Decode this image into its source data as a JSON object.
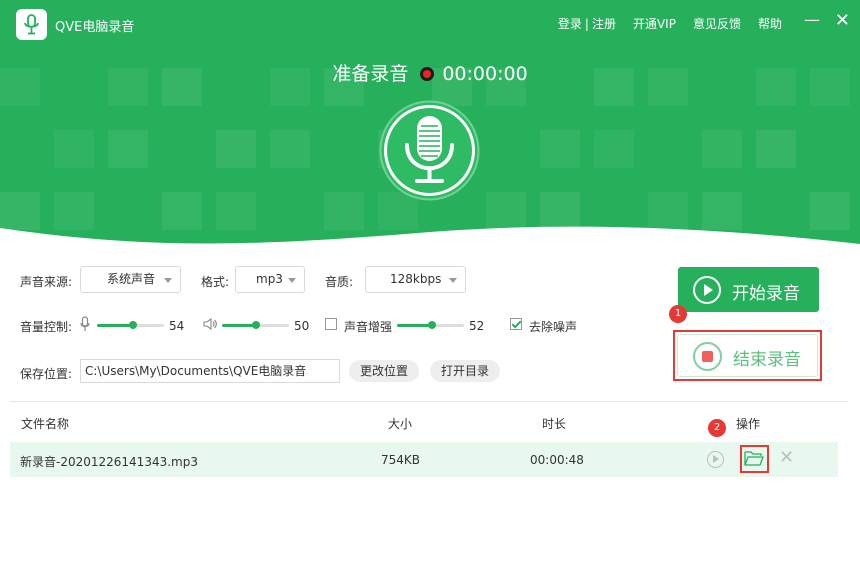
{
  "app": {
    "title": "QVE电脑录音"
  },
  "topnav": {
    "login": "登录",
    "separator": "|",
    "register": "注册",
    "vip": "开通VIP",
    "feedback": "意见反馈",
    "help": "帮助"
  },
  "window": {
    "minimize": "—",
    "close": "✕"
  },
  "status": {
    "text": "准备录音",
    "time": "00:00:00"
  },
  "settings": {
    "source_label": "声音来源:",
    "source_value": "系统声音",
    "format_label": "格式:",
    "format_value": "mp3",
    "quality_label": "音质:",
    "quality_value": "128kbps",
    "volume_label": "音量控制:",
    "mic_volume": 54,
    "speaker_volume": 50,
    "boost_label": "声音增强",
    "boost_checked": false,
    "boost_value": 52,
    "denoise_label": "去除噪声",
    "denoise_checked": true,
    "save_label": "保存位置:",
    "save_path": "C:\\Users\\My\\Documents\\QVE电脑录音",
    "change_location": "更改位置",
    "open_dir": "打开目录"
  },
  "actions": {
    "start": "开始录音",
    "stop": "结束录音"
  },
  "badges": {
    "one": "1",
    "two": "2"
  },
  "table": {
    "headers": {
      "name": "文件名称",
      "size": "大小",
      "duration": "时长",
      "ops": "操作"
    },
    "rows": [
      {
        "name": "新录音-20201226141343.mp3",
        "size": "754KB",
        "duration": "00:00:48"
      }
    ]
  },
  "colors": {
    "brand": "#27b05b",
    "danger": "#e53935",
    "row_bg": "#e9f8ee"
  },
  "icons": {
    "logo": "microphone-icon",
    "mic": "microphone-icon",
    "speaker": "speaker-icon",
    "play": "play-icon",
    "folder": "folder-icon",
    "delete": "close-icon"
  }
}
